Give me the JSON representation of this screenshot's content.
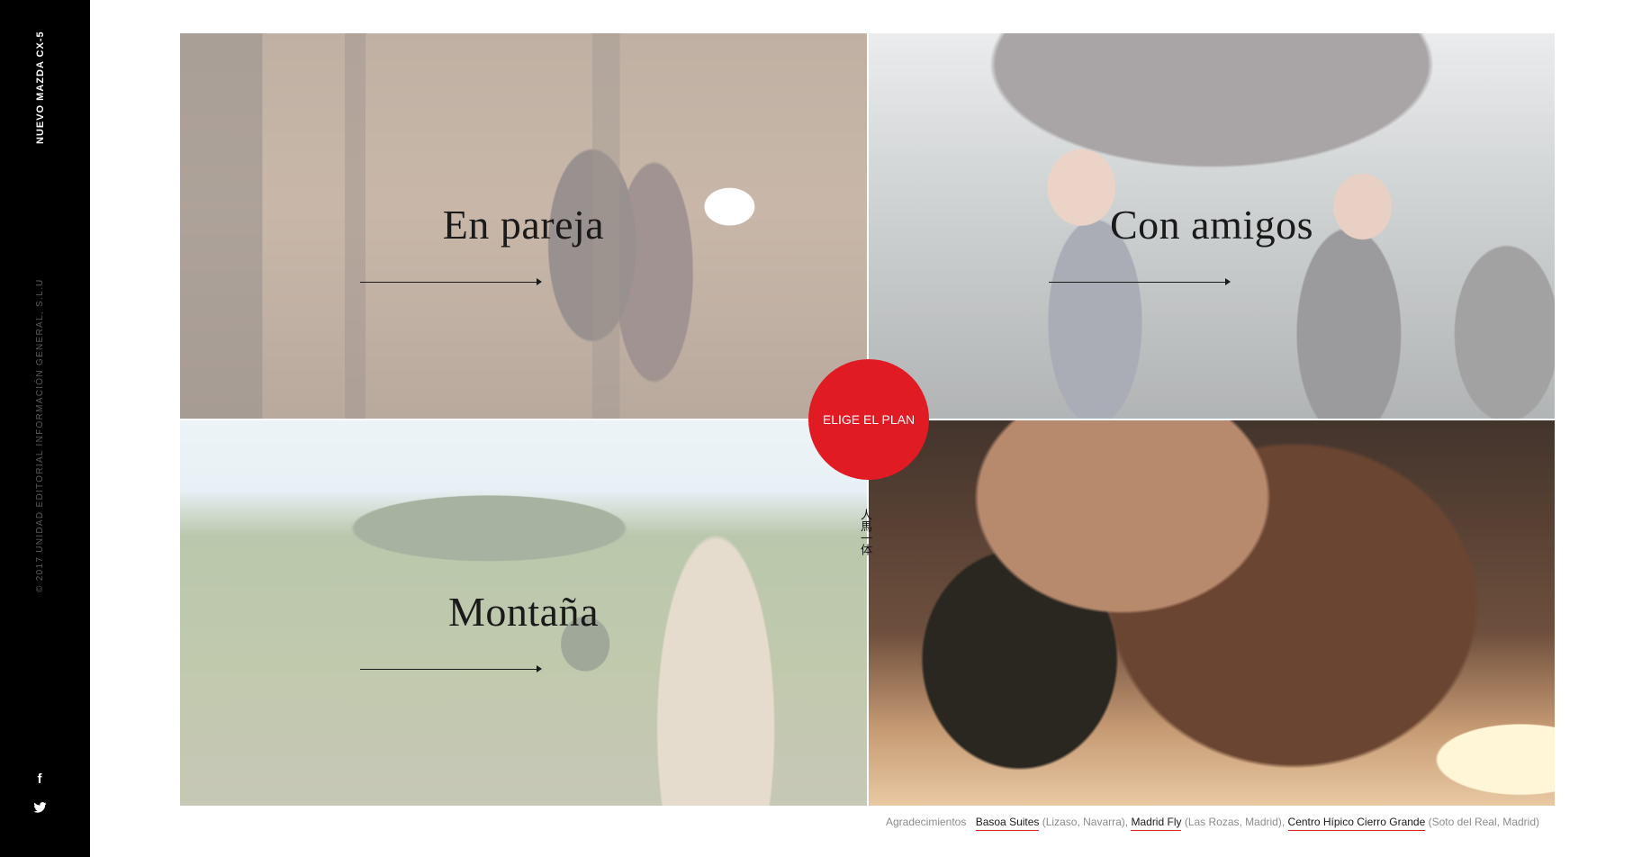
{
  "sidebar": {
    "brand": "NUEVO MAZDA CX-5",
    "copyright": "© 2017 UNIDAD EDITORIAL INFORMACIÓN GENERAL, S.L.U",
    "social": [
      {
        "icon": "facebook-icon",
        "glyph": "f"
      },
      {
        "icon": "twitter-icon",
        "glyph": ""
      }
    ]
  },
  "tiles": [
    {
      "title": "En pareja",
      "image": "couple-bedroom"
    },
    {
      "title": "Con amigos",
      "image": "friends-in-car"
    },
    {
      "title": "Montaña",
      "image": "mountain-trail"
    },
    {
      "title": "",
      "image": "man-with-horse"
    }
  ],
  "plan_button": {
    "label": "ELIGE EL PLAN"
  },
  "kanji": "人馬一体",
  "credits": {
    "label": "Agradecimientos",
    "items": [
      {
        "name": "Basoa Suites",
        "place": " (Lizaso, Navarra),"
      },
      {
        "name": "Madrid Fly",
        "place": " (Las Rozas, Madrid),"
      },
      {
        "name": "Centro Hípico Cierro Grande",
        "place": " (Soto del Real, Madrid)"
      }
    ]
  },
  "colors": {
    "accent": "#e11b24",
    "sidebar_bg": "#000000",
    "text": "#1a1a1a"
  }
}
